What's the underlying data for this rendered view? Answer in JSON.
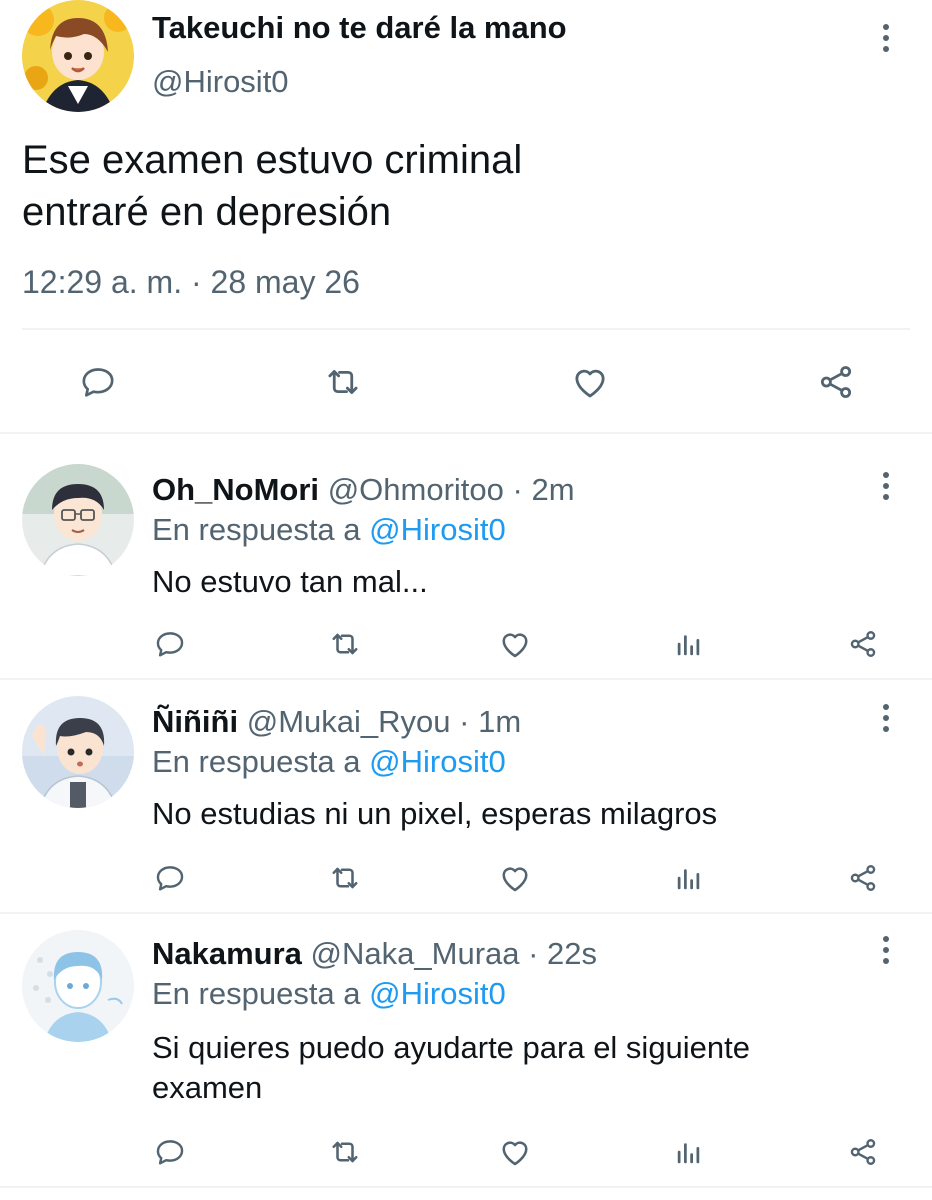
{
  "main_tweet": {
    "name": "Takeuchi no te daré la mano",
    "handle": "@Hirosit0",
    "text_lines": [
      "Ese examen estuvo criminal",
      "entraré en depresión"
    ],
    "timestamp": "12:29 a. m. · 28 may 26",
    "actions": [
      "reply-icon",
      "retweet-icon",
      "like-icon",
      "share-icon"
    ]
  },
  "replies": [
    {
      "name": "Oh_NoMori",
      "handle": "@Ohmoritoo",
      "time": "· 2m",
      "replying_prefix": "En respuesta a",
      "replying_to": "@Hirosit0",
      "text": "No estuvo tan mal...",
      "actions": [
        "reply-icon",
        "retweet-icon",
        "like-icon",
        "analytics-icon",
        "share-icon"
      ]
    },
    {
      "name": "Ñiñiñi",
      "handle": "@Mukai_Ryou",
      "time": "· 1m",
      "replying_prefix": "En respuesta a",
      "replying_to": "@Hirosit0",
      "text": "No estudias ni un pixel, esperas milagros",
      "actions": [
        "reply-icon",
        "retweet-icon",
        "like-icon",
        "analytics-icon",
        "share-icon"
      ]
    },
    {
      "name": "Nakamura",
      "handle": "@Naka_Muraa",
      "time": "· 22s",
      "replying_prefix": "En respuesta a",
      "replying_to": "@Hirosit0",
      "text": "Si quieres puedo ayudarte para el siguiente examen",
      "actions": [
        "reply-icon",
        "retweet-icon",
        "like-icon",
        "analytics-icon",
        "share-icon"
      ]
    }
  ],
  "colors": {
    "text_primary": "#0f1419",
    "text_secondary": "#536471",
    "link": "#1d9bf0",
    "divider": "#eff3f4",
    "icon": "#536471"
  }
}
